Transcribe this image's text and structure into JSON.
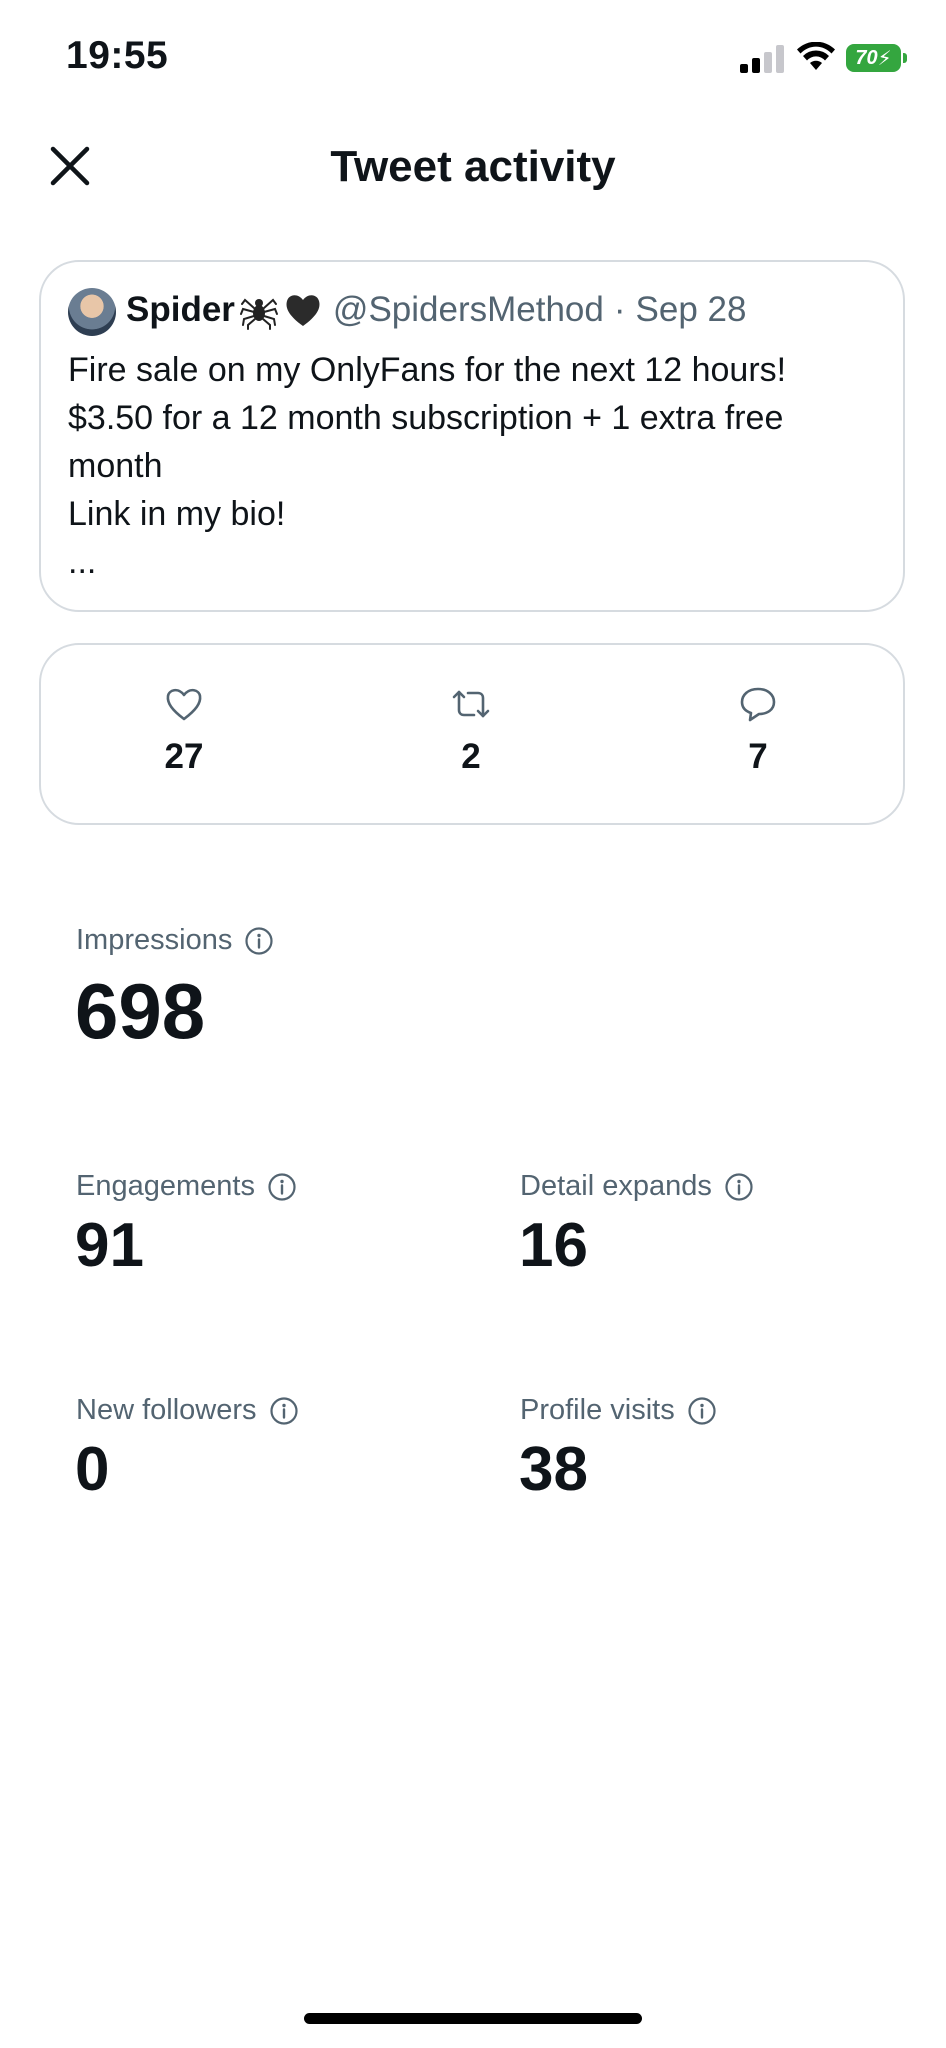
{
  "status_bar": {
    "time": "19:55",
    "battery": "70"
  },
  "header": {
    "title": "Tweet activity"
  },
  "tweet": {
    "author_name": "Spider",
    "handle": "@SpidersMethod",
    "separator": "·",
    "date": "Sep 28",
    "lines": [
      "Fire sale on my OnlyFans for the next 12 hours!",
      "$3.50 for a 12 month subscription + 1 extra free",
      "month",
      "Link in my bio!",
      "..."
    ]
  },
  "engagement": {
    "likes": "27",
    "retweets": "2",
    "replies": "7"
  },
  "metrics": {
    "impressions": {
      "label": "Impressions",
      "value": "698"
    },
    "engagements": {
      "label": "Engagements",
      "value": "91"
    },
    "detail_expands": {
      "label": "Detail expands",
      "value": "16"
    },
    "new_followers": {
      "label": "New followers",
      "value": "0"
    },
    "profile_visits": {
      "label": "Profile visits",
      "value": "38"
    }
  }
}
